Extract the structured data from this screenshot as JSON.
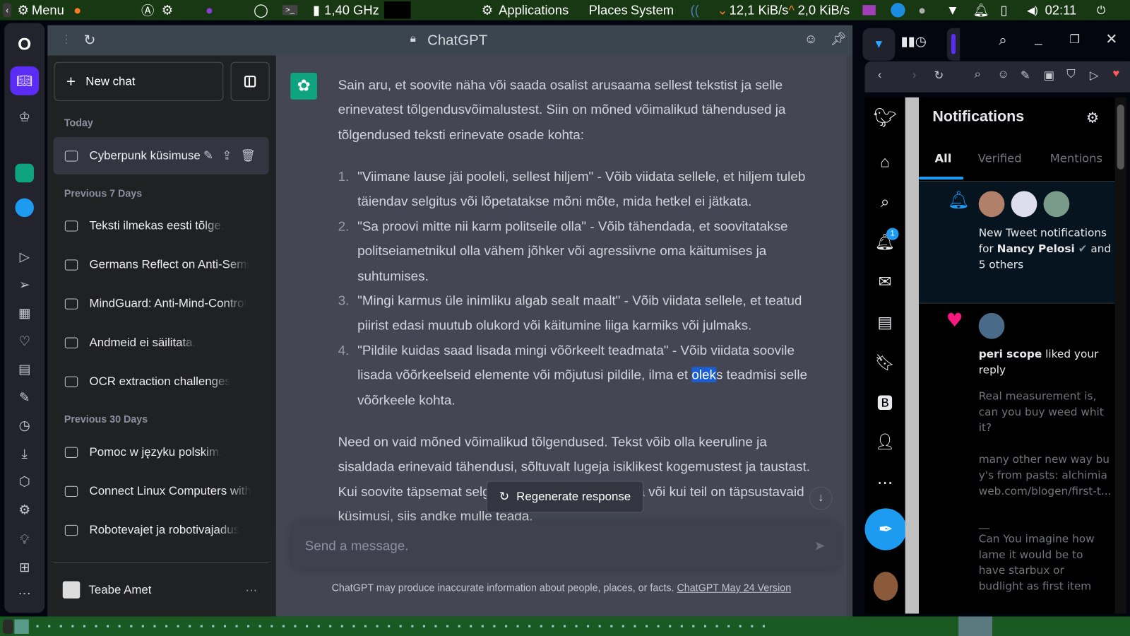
{
  "topbar": {
    "menu": "Menu",
    "cpu": "1,40 GHz",
    "applications": "Applications",
    "places": "Places",
    "system": "System",
    "net_down": "12,1 KiB/s",
    "net_up": "2,0 KiB/s",
    "clock": "02:11"
  },
  "chatgpt": {
    "title": "ChatGPT",
    "new_chat": "New chat",
    "sections": [
      {
        "label": "Today",
        "items": [
          "Cyberpunk küsimuse"
        ]
      },
      {
        "label": "Previous 7 Days",
        "items": [
          "Teksti ilmekas eesti tõlge.",
          "Germans Reflect on Anti-Semi",
          "MindGuard: Anti-Mind-Control",
          "Andmeid ei säilitata.",
          "OCR extraction challenges"
        ]
      },
      {
        "label": "Previous 30 Days",
        "items": [
          "Pomoc w języku polskim.",
          "Connect Linux Computers with",
          "Robotevajet ja robotivajadus"
        ]
      }
    ],
    "user": "Teabe Amet",
    "message": {
      "intro": "Sain aru, et soovite näha või saada osalist arusaama sellest tekstist ja selle erinevatest tõlgendusvõimalustest. Siin on mõned võimalikud tähendused ja tõlgendused teksti erinevate osade kohta:",
      "items": [
        {
          "n": "1.",
          "text": "\"Viimane lause jäi pooleli, sellest hiljem\" - Võib viidata sellele, et hiljem tuleb täiendav selgitus või lõpetatakse mõni mõte, mida hetkel ei jätkata."
        },
        {
          "n": "2.",
          "text": "\"Sa proovi mitte nii karm politseile olla\" - Võib tähendada, et soovitatakse politseiametnikul olla vähem jõhker või agressiivne oma käitumises ja suhtumises."
        },
        {
          "n": "3.",
          "text": "\"Mingi karmus üle inimliku algab sealt maalt\" - Võib viidata sellele, et teatud piirist edasi muutub olukord või käitumine liiga karmiks või julmaks."
        },
        {
          "n": "4.",
          "pre": "\"Pildile kuidas saad lisada mingi võõrkeelt teadmata\" - Võib viidata soovile lisada võõrkeelseid elemente või mõjutusi pildile, ilma et ",
          "sel": "olek",
          "post": "s teadmisi selle võõrkeele kohta."
        }
      ],
      "outro": "Need on vaid mõned võimalikud tõlgendused. Tekst võib olla keeruline ja sisaldada erinevaid tähendusi, sõltuvalt lugeja isiklikest kogemustest ja taustast. Kui soovite täpsemat selgitust konkreetse osa kohta või kui teil on täpsustavaid küsimusi, siis andke mulle teada."
    },
    "regenerate": "Regenerate response",
    "input_placeholder": "Send a message.",
    "disclaimer": "ChatGPT may produce inaccurate information about people, places, or facts.",
    "version_link": "ChatGPT May 24 Version"
  },
  "twitter": {
    "title": "Notifications",
    "tabs": [
      "All",
      "Verified",
      "Mentions"
    ],
    "badge": "1",
    "n1": {
      "pre": "New Tweet notifications for ",
      "name": "Nancy Pelosi",
      "post": " and",
      "more": "5 others"
    },
    "n2": {
      "name": "peri scope",
      "action": " liked your reply",
      "quote": [
        "Real measurement is, can you buy weed whit it?",
        "many other new way buy's from pasts: alchimiaweb.com/blogen/first-t...",
        "__",
        "Can You imagine how lame it would be to have starbux or budlight as first item"
      ]
    }
  },
  "colors": {
    "accent": "#10a37f",
    "twitter": "#1d9bf0",
    "opera": "#5b2cf5",
    "like": "#f91880"
  }
}
